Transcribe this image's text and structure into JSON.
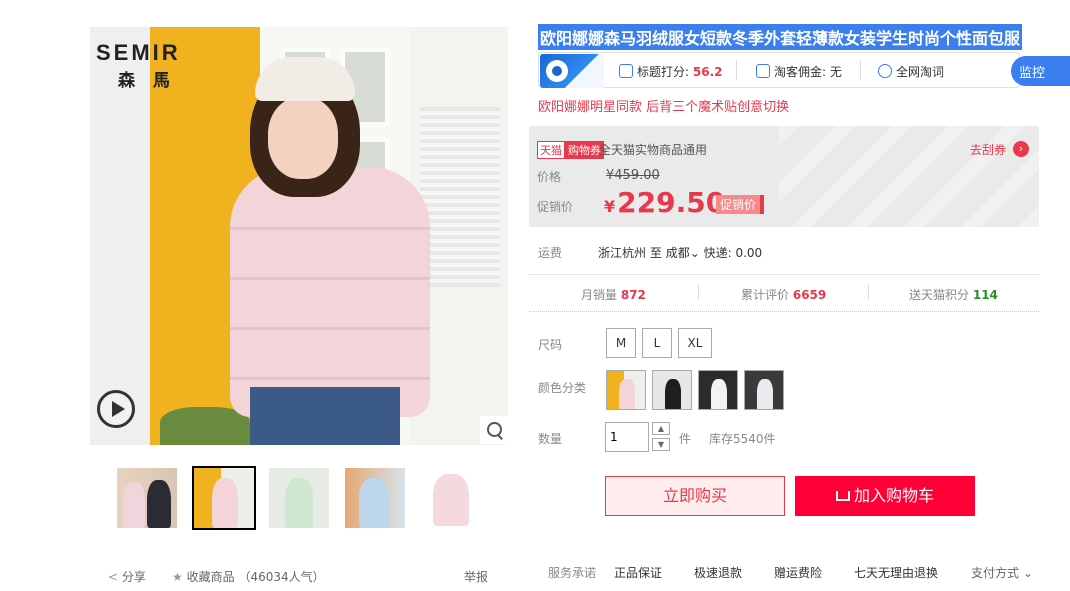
{
  "gallery": {
    "brand_en": "SEMIR",
    "brand_cn": "森 馬",
    "share_label": "分享",
    "favorite_label": "收藏商品",
    "favorite_count": "（46034人气）",
    "report_label": "举报"
  },
  "product": {
    "title": "欧阳娜娜森马羽绒服女短款冬季外套轻薄款女装学生时尚个性面包服",
    "subtitle": "欧阳娜娜明星同款 后背三个魔术贴创意切换"
  },
  "plugin": {
    "score_label": "标题打分:",
    "score_value": "56.2",
    "commission_label": "淘客佣金:",
    "commission_value": "无",
    "search_label": "全网淘词",
    "monitor_label": "监控"
  },
  "price": {
    "tmall_tag": "天猫",
    "coupon_tag": "购物券",
    "coupon_desc": "全天猫实物商品通用",
    "get_coupon": "去刮券",
    "price_label": "价格",
    "original_price": "¥459.00",
    "promo_label": "促销价",
    "currency": "¥",
    "promo_price": "229.50",
    "promo_tag": "促销价"
  },
  "shipping": {
    "label": "运费",
    "from": "浙江杭州",
    "to_word": "至",
    "to": "成都",
    "express": "快递: 0.00"
  },
  "stats": {
    "monthly_sales_label": "月销量",
    "monthly_sales": "872",
    "reviews_label": "累计评价",
    "reviews": "6659",
    "points_label": "送天猫积分",
    "points": "114"
  },
  "options": {
    "size_label": "尺码",
    "sizes": [
      "M",
      "L",
      "XL"
    ],
    "color_label": "颜色分类",
    "qty_label": "数量",
    "qty_value": "1",
    "qty_unit": "件",
    "stock": "库存5540件"
  },
  "actions": {
    "buy_now": "立即购买",
    "add_cart": "加入购物车"
  },
  "services": {
    "label": "服务承诺",
    "items": [
      "正品保证",
      "极速退款",
      "赠运费险",
      "七天无理由退换"
    ],
    "pay": "支付方式"
  },
  "colors": {
    "accent": "#e8384b",
    "cart_red": "#ff0036",
    "plugin_blue": "#3b7ef0"
  }
}
